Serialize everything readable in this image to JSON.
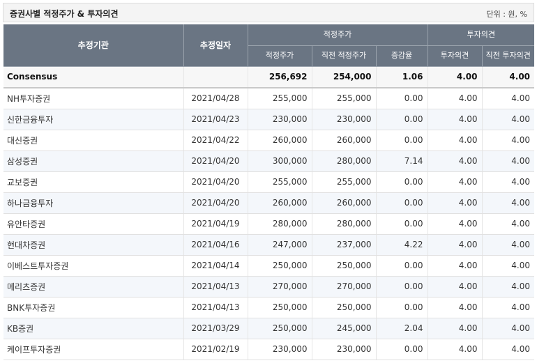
{
  "header": {
    "title": "증권사별 적정주가 & 투자의견",
    "unit": "단위 : 원, %"
  },
  "columns": {
    "institution": "추정기관",
    "date": "추정일자",
    "target_price_group": "적정주가",
    "opinion_group": "투자의견",
    "target_price": "적정주가",
    "prev_target_price": "직전 적정주가",
    "change_rate": "증감율",
    "opinion": "투자의견",
    "prev_opinion": "직전 투자의견"
  },
  "consensus": {
    "name": "Consensus",
    "date": "",
    "target_price": "256,692",
    "prev_target_price": "254,000",
    "change_rate": "1.06",
    "opinion": "4.00",
    "prev_opinion": "4.00"
  },
  "rows": [
    {
      "name": "NH투자증권",
      "date": "2021/04/28",
      "target_price": "255,000",
      "prev_target_price": "255,000",
      "change_rate": "0.00",
      "opinion": "4.00",
      "prev_opinion": "4.00"
    },
    {
      "name": "신한금융투자",
      "date": "2021/04/23",
      "target_price": "230,000",
      "prev_target_price": "230,000",
      "change_rate": "0.00",
      "opinion": "4.00",
      "prev_opinion": "4.00"
    },
    {
      "name": "대신증권",
      "date": "2021/04/22",
      "target_price": "260,000",
      "prev_target_price": "260,000",
      "change_rate": "0.00",
      "opinion": "4.00",
      "prev_opinion": "4.00"
    },
    {
      "name": "삼성증권",
      "date": "2021/04/20",
      "target_price": "300,000",
      "prev_target_price": "280,000",
      "change_rate": "7.14",
      "opinion": "4.00",
      "prev_opinion": "4.00"
    },
    {
      "name": "교보증권",
      "date": "2021/04/20",
      "target_price": "255,000",
      "prev_target_price": "255,000",
      "change_rate": "0.00",
      "opinion": "4.00",
      "prev_opinion": "4.00"
    },
    {
      "name": "하나금융투자",
      "date": "2021/04/20",
      "target_price": "260,000",
      "prev_target_price": "260,000",
      "change_rate": "0.00",
      "opinion": "4.00",
      "prev_opinion": "4.00"
    },
    {
      "name": "유안타증권",
      "date": "2021/04/19",
      "target_price": "280,000",
      "prev_target_price": "280,000",
      "change_rate": "0.00",
      "opinion": "4.00",
      "prev_opinion": "4.00"
    },
    {
      "name": "현대차증권",
      "date": "2021/04/16",
      "target_price": "247,000",
      "prev_target_price": "237,000",
      "change_rate": "4.22",
      "opinion": "4.00",
      "prev_opinion": "4.00"
    },
    {
      "name": "이베스트투자증권",
      "date": "2021/04/14",
      "target_price": "250,000",
      "prev_target_price": "250,000",
      "change_rate": "0.00",
      "opinion": "4.00",
      "prev_opinion": "4.00"
    },
    {
      "name": "메리츠증권",
      "date": "2021/04/13",
      "target_price": "270,000",
      "prev_target_price": "270,000",
      "change_rate": "0.00",
      "opinion": "4.00",
      "prev_opinion": "4.00"
    },
    {
      "name": "BNK투자증권",
      "date": "2021/04/13",
      "target_price": "250,000",
      "prev_target_price": "250,000",
      "change_rate": "0.00",
      "opinion": "4.00",
      "prev_opinion": "4.00"
    },
    {
      "name": "KB증권",
      "date": "2021/03/29",
      "target_price": "250,000",
      "prev_target_price": "245,000",
      "change_rate": "2.04",
      "opinion": "4.00",
      "prev_opinion": "4.00"
    },
    {
      "name": "케이프투자증권",
      "date": "2021/02/19",
      "target_price": "230,000",
      "prev_target_price": "230,000",
      "change_rate": "0.00",
      "opinion": "4.00",
      "prev_opinion": "4.00"
    }
  ]
}
